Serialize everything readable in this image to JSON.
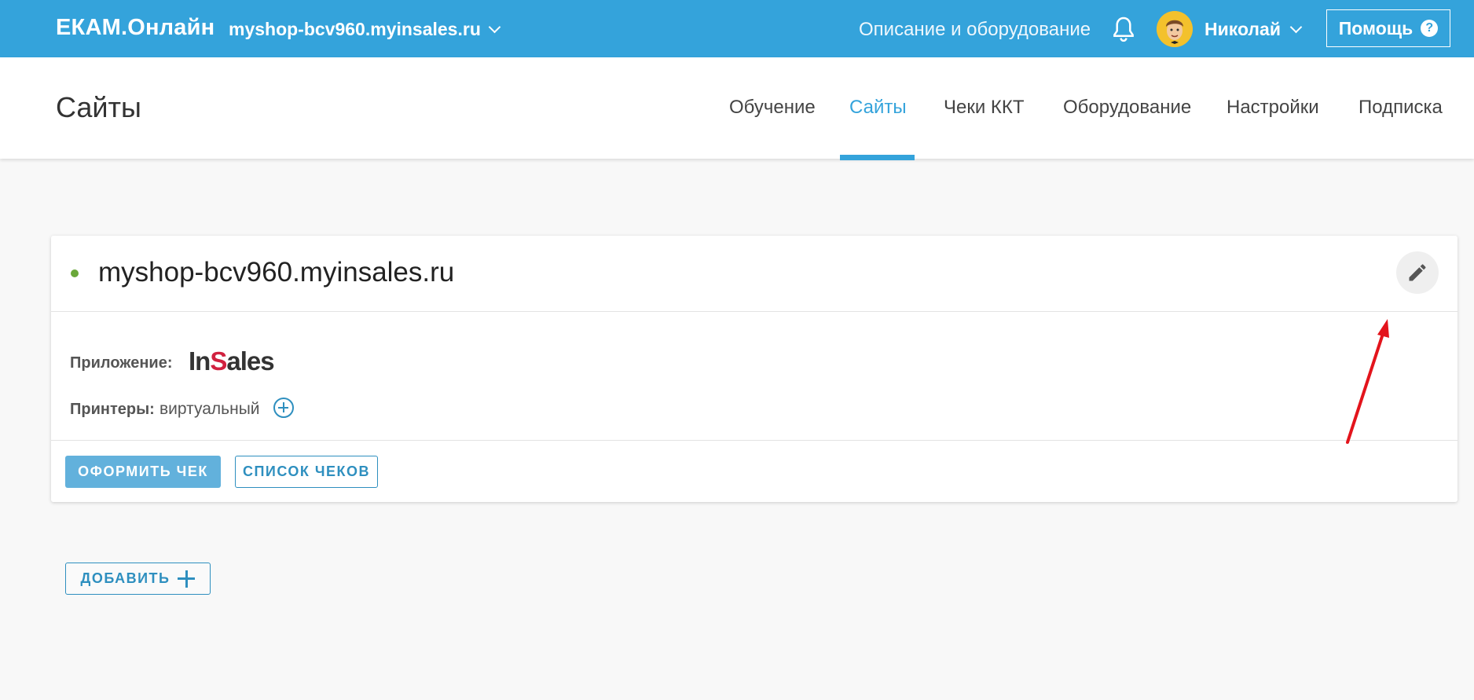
{
  "topbar": {
    "brand": "ЕКАМ.Онлайн",
    "site": "myshop-bcv960.myinsales.ru",
    "link": "Описание и оборудование",
    "user": "Николай",
    "help": "Помощь",
    "help_icon": "?",
    "bg_color": "#34a3db"
  },
  "subheader": {
    "title": "Сайты",
    "nav": [
      "Обучение",
      "Сайты",
      "Чеки ККТ",
      "Оборудование",
      "Настройки",
      "Подписка"
    ],
    "active_index": 1
  },
  "card": {
    "title": "myshop-bcv960.myinsales.ru",
    "status_color": "#6aa83a",
    "app_label": "Приложение:",
    "app_logo": "InSales",
    "printers_label": "Принтеры:",
    "printers_value": "виртуальный",
    "btn_primary": "ОФОРМИТЬ ЧЕК",
    "btn_secondary": "СПИСОК ЧЕКОВ"
  },
  "add_button": "ДОБАВИТЬ",
  "icons": {
    "bell": "bell-icon",
    "edit": "pencil-icon",
    "add_printer": "plus-circle-icon",
    "add": "plus-icon",
    "annotation": "red-arrow"
  }
}
